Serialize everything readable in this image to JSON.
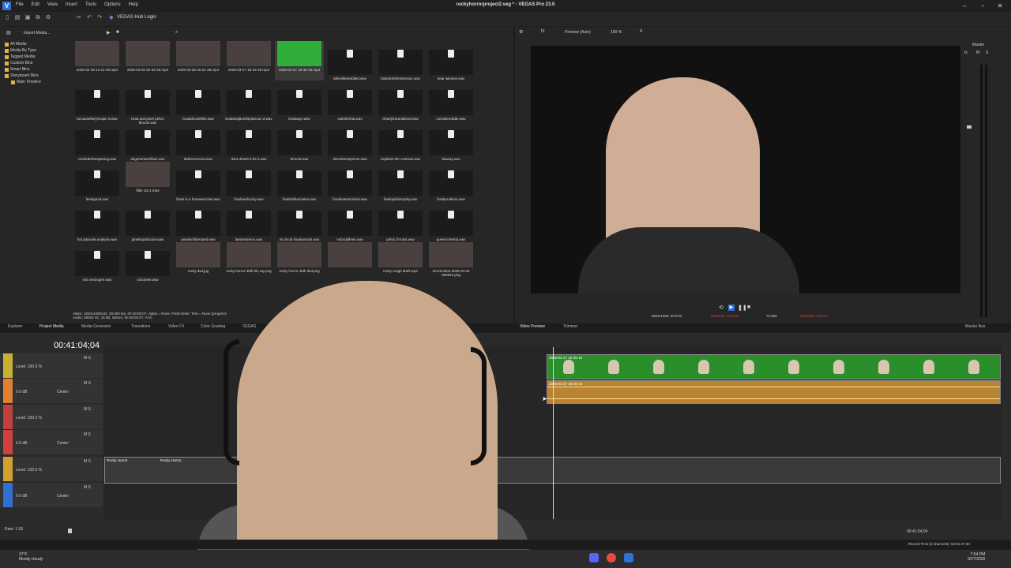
{
  "app": {
    "title": "rockyhorrorproject2.veg * - VEGAS Pro 23.0",
    "icon": "V"
  },
  "menu": [
    "File",
    "Edit",
    "View",
    "Insert",
    "Tools",
    "Options",
    "Help"
  ],
  "toolbar": {
    "hub": "VEGAS Hub Login"
  },
  "explorer": {
    "import": "Import Media...",
    "tree": [
      "All Media",
      "Media By Type",
      "Tagged Media",
      "Custom Bins",
      "Smart Bins",
      "Storyboard Bins",
      "Main Timeline"
    ],
    "items": [
      {
        "label": "2026-02-28 12-21-30.mp4",
        "kind": "video"
      },
      {
        "label": "2026-03-25 20-20-18.mp4",
        "kind": "video"
      },
      {
        "label": "2026-03-25 20-21-38.mp4",
        "kind": "video"
      },
      {
        "label": "2026-03-27 18-16-29.mp4",
        "kind": "video"
      },
      {
        "label": "2026-03-27 18-35-15.mp4",
        "kind": "green"
      },
      {
        "label": "afterelliesiskilled.wav",
        "kind": "wav"
      },
      {
        "label": "basedontheirtension.wav",
        "kind": "wav"
      },
      {
        "label": "bear witness.wav",
        "kind": "wav"
      },
      {
        "label": "becausetheyrerape d.wav",
        "kind": "wav"
      },
      {
        "label": "brad and janet pelvic thrusts.wav",
        "kind": "wav"
      },
      {
        "label": "bradalmostfells.wav",
        "kind": "wav"
      },
      {
        "label": "bradandjanetkeptaroun d.wav",
        "kind": "wav"
      },
      {
        "label": "bradsays.wav",
        "kind": "wav"
      },
      {
        "label": "catinthehat.wav",
        "kind": "wav"
      },
      {
        "label": "clearlytraumatized.wav",
        "kind": "wav"
      },
      {
        "label": "considereddie.wav",
        "kind": "wav"
      },
      {
        "label": "considertheopening.wav",
        "kind": "wav"
      },
      {
        "label": "degeneratevillain.wav",
        "kind": "wav"
      },
      {
        "label": "didntcomeout.wav",
        "kind": "wav"
      },
      {
        "label": "dont dream it be it.wav",
        "kind": "wav"
      },
      {
        "label": "drscott.wav",
        "kind": "wav"
      },
      {
        "label": "drscottsresponse.wav",
        "kind": "wav"
      },
      {
        "label": "explains the contrast.wav",
        "kind": "wav"
      },
      {
        "label": "faeway.wav",
        "kind": "wav"
      },
      {
        "label": "feelsgood.wav",
        "kind": "wav"
      },
      {
        "label": "filler cat 1.mp4",
        "kind": "video"
      },
      {
        "label": "frank is a homewrecker.wav",
        "kind": "wav"
      },
      {
        "label": "frankandrocky.wav",
        "kind": "wav"
      },
      {
        "label": "frankhallucinates.wav",
        "kind": "wav"
      },
      {
        "label": "frankisanarcissist.wav",
        "kind": "wav"
      },
      {
        "label": "franksphilosophy.wav",
        "kind": "wav"
      },
      {
        "label": "frankproblem.wav",
        "kind": "wav"
      },
      {
        "label": "hot patootie analysis.wav",
        "kind": "wav"
      },
      {
        "label": "janetinparticular.wav",
        "kind": "wav"
      },
      {
        "label": "janetisntliberated.wav",
        "kind": "wav"
      },
      {
        "label": "lastsentence.wav",
        "kind": "wav"
      },
      {
        "label": "my local shadowcast.wav",
        "kind": "wav"
      },
      {
        "label": "nobodyflees.wav",
        "kind": "wav"
      },
      {
        "label": "pelvic thrusts.wav",
        "kind": "wav"
      },
      {
        "label": "queercontend.wav",
        "kind": "wav"
      },
      {
        "label": "rob oestrogen.wav",
        "kind": "wav"
      },
      {
        "label": "robcloset.wav",
        "kind": "wav"
      },
      {
        "label": "rocky dvd.jpg",
        "kind": "video"
      },
      {
        "label": "rocky horror 35th blu ray.png",
        "kind": "video"
      },
      {
        "label": "rocky horror 45th dvd.png",
        "kind": "video"
      },
      {
        "label": "",
        "kind": "video"
      },
      {
        "label": "rocky rough draft.mp4",
        "kind": "video"
      },
      {
        "label": "Screenshot 2026-03-02 000922.png",
        "kind": "video"
      }
    ],
    "status1": "Video: 1920x1080x32, 30.000 fps, 00:48:05:07, Alpha = None, Field Order: Test = None (progress",
    "status2": "Audio: 48000 Hz, 16 Bit, Stereo, 00:48:05:07, AAC"
  },
  "preview": {
    "mode": "Preview (Auto)",
    "zoom": "100 %",
    "res1": "1920x1080, 29.970i",
    "res2": "960x540, 29.970p",
    "frame": "73,850",
    "res3": "1120x630, 29.970"
  },
  "master": {
    "label": "Master",
    "fx": "fx",
    "m": "M",
    "s": "S",
    "bottom": "Master Bus"
  },
  "tabs": [
    "Explorer",
    "Project Media",
    "Media Generator",
    "Transitions",
    "Video FX",
    "Color Grading",
    "VEGAS",
    "Video Preview",
    "Trimmer"
  ],
  "timeline": {
    "timecode": "00:41:04;04",
    "tracks": [
      {
        "level": "Level: 100.0 %",
        "color": "#c8b030"
      },
      {
        "level": "0.0 dB",
        "pan": "Center",
        "color": "#e08030"
      },
      {
        "level": "Level: 100.0 %",
        "color": "#c04040"
      },
      {
        "level": "0.0 dB",
        "pan": "Center",
        "color": "#d04040"
      },
      {
        "level": "Level: 100.0 %",
        "color": "#d0a030"
      },
      {
        "level": "0.0 dB",
        "pan": "Center",
        "color": "#3070d0"
      }
    ],
    "clip_green": "2026-03-27 18-35-15",
    "clip_audio": "2026-03-27 18-35-15",
    "clip_v1": "Rocky Horror",
    "clip_v2": "Rocky Horror",
    "rate": "Rate: 1.00",
    "end_time": "00:41:04;04",
    "record": "Record Time (2 channels): 53:04:47:30"
  },
  "taskbar": {
    "temp": "37°F",
    "weather": "Mostly cloudy",
    "time": "7:54 PM",
    "date": "3/27/2026"
  }
}
